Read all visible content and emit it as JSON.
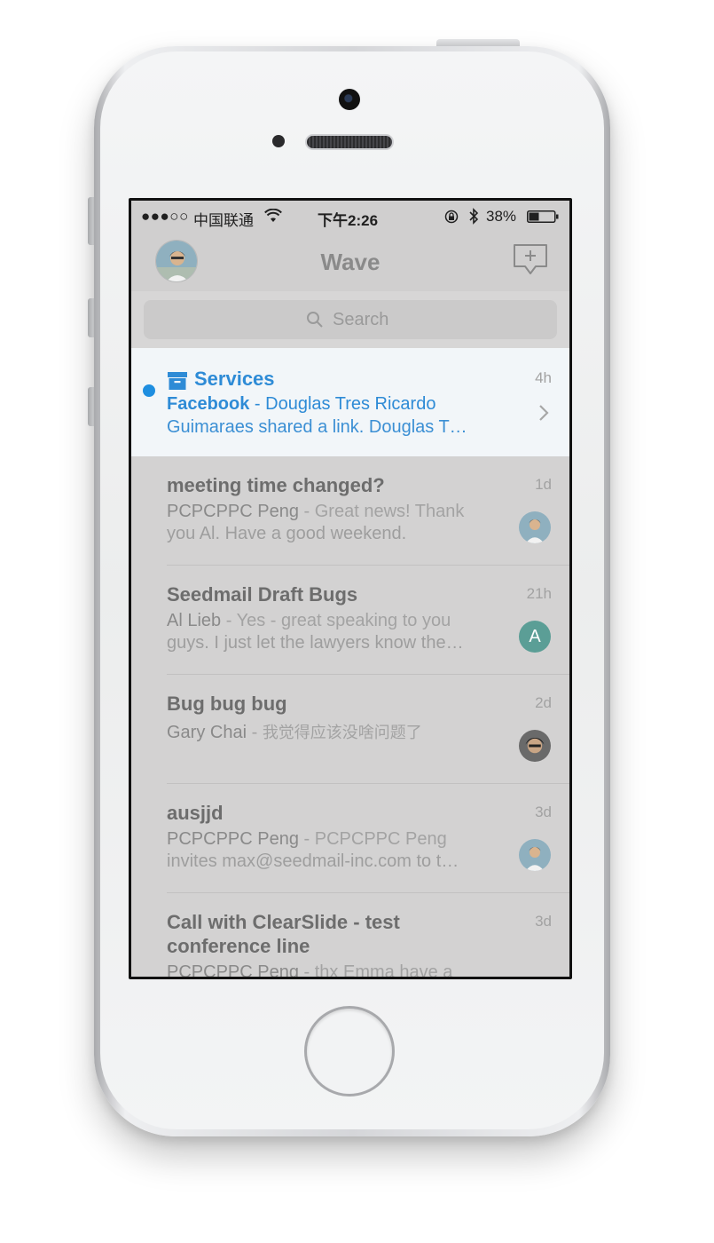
{
  "status_bar": {
    "signal": "●●●○○",
    "carrier": "中国联通",
    "time": "下午2:26",
    "battery": "38%"
  },
  "nav": {
    "title": "Wave",
    "left_icon": "profile-avatar",
    "right_icon": "compose-icon"
  },
  "search": {
    "placeholder": "Search"
  },
  "threads": [
    {
      "subject": "Services",
      "time": "4h",
      "sender": "Facebook",
      "separator": " - ",
      "preview_line1": "Douglas Tres Ricardo",
      "preview_line2": "Guimaraes shared a link. Douglas T…",
      "unread": true,
      "icon": "archive-icon",
      "accent": "#2e8bd6"
    },
    {
      "subject": "meeting time changed?",
      "time": "1d",
      "sender": "PCPCPPC Peng",
      "separator": " - ",
      "preview_line1": "Great news! Thank",
      "preview_line2": "you Al. Have a good weekend.",
      "avatar": "photo"
    },
    {
      "subject": "Seedmail Draft Bugs",
      "time": "21h",
      "sender": "Al Lieb",
      "separator": " - ",
      "preview_line1": "Yes - great speaking to you",
      "preview_line2": "guys. I just let the lawyers know the…",
      "avatar_letter": "A",
      "avatar_color": "#5b9e96"
    },
    {
      "subject": "Bug bug bug",
      "time": "2d",
      "sender": "Gary Chai",
      "separator": " - ",
      "preview_line1": "我觉得应该没啥问题了",
      "preview_line2": "",
      "avatar": "photo"
    },
    {
      "subject": "ausjjd",
      "time": "3d",
      "sender": "PCPCPPC Peng",
      "separator": " - ",
      "preview_line1": "PCPCPPC Peng",
      "preview_line2": "invites max@seedmail-inc.com to t…",
      "avatar": "photo"
    },
    {
      "subject_line1": "Call with ClearSlide - test",
      "subject_line2": "conference line",
      "time": "3d",
      "sender": "PCPCPPC Peng",
      "separator": " - ",
      "preview_line1": "thx Emma have a"
    }
  ]
}
